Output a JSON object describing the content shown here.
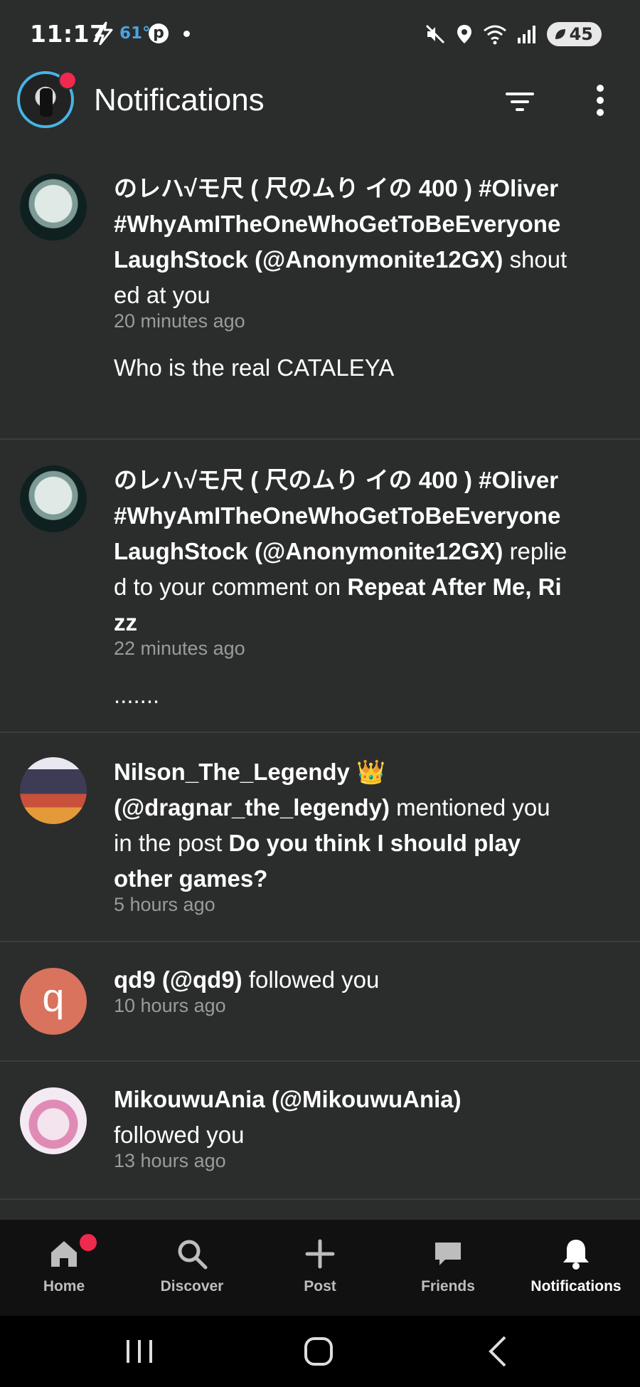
{
  "status_bar": {
    "time": "11:17",
    "temperature": "61°",
    "battery": "45",
    "icons": [
      "bolt-icon",
      "pinterest-icon",
      "mute-icon",
      "location-icon",
      "wifi-icon",
      "signal-icon",
      "battery-icon"
    ]
  },
  "header": {
    "title": "Notifications",
    "filter_icon": "filter-icon",
    "more_icon": "more-vertical-icon"
  },
  "notifications": [
    {
      "actor": "のレハ√モ尺 ( 尺のムり イの 400 ) #Oliver #WhyAmITheOneWhoGetToBeEveryoneLaughStock (@Anonymonite12GX)",
      "action": "shouted at you",
      "target": "",
      "time": "20 minutes ago",
      "preview": "Who is the real CATALEYA"
    },
    {
      "actor": "のレハ√モ尺 ( 尺のムり イの 400 ) #Oliver #WhyAmITheOneWhoGetToBeEveryoneLaughStock (@Anonymonite12GX)",
      "action": "replied to your comment on",
      "target": "Repeat After Me, Rizz",
      "time": "22 minutes ago",
      "preview": "......."
    },
    {
      "actor": "Nilson_The_Legendy 👑 (@dragnar_the_legendy)",
      "action": "mentioned you in the post",
      "target": "Do you think I should play other games?",
      "time": "5 hours ago",
      "preview": ""
    },
    {
      "actor": "qd9 (@qd9)",
      "action": "followed you",
      "target": "",
      "time": "10 hours ago",
      "preview": "",
      "avatar_letter": "q"
    },
    {
      "actor": "MikouwuAnia (@MikouwuAnia)",
      "action": "followed you",
      "target": "",
      "time": "13 hours ago",
      "preview": ""
    }
  ],
  "bottom_nav": [
    {
      "label": "Home",
      "icon": "home-icon"
    },
    {
      "label": "Discover",
      "icon": "search-icon"
    },
    {
      "label": "Post",
      "icon": "plus-icon"
    },
    {
      "label": "Friends",
      "icon": "chat-icon"
    },
    {
      "label": "Notifications",
      "icon": "bell-icon",
      "active": true
    }
  ],
  "colors": {
    "background": "#2b2c2c",
    "nav_background": "#111111",
    "badge": "#f0294e",
    "avatar_ring": "#45b5e6"
  }
}
